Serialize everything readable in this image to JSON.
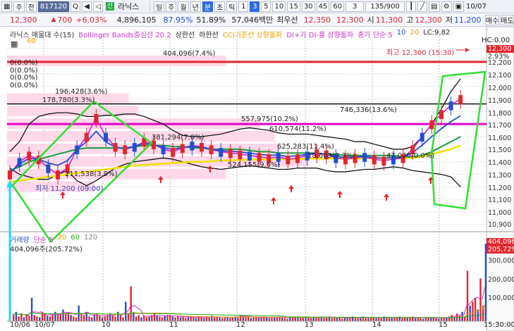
{
  "toolbar1": {
    "period_label": "주",
    "period_label2": "전",
    "code": "817120",
    "stock_name": "라닉스",
    "day": "일",
    "week": "주",
    "month": "월",
    "year": "년",
    "min": "분",
    "sec": "초",
    "tick": "틱",
    "intervals": [
      "1",
      "3",
      "5",
      "10",
      "15",
      "30",
      "45",
      "60"
    ],
    "interval_selected": "3",
    "count": "3",
    "page": "135/900",
    "date": "10/07"
  },
  "toolbar2": {
    "price": "12,300",
    "change_arrow": "▲",
    "change": "700",
    "change_pct": "+6.03%",
    "volume": "4,896,105",
    "vol_ratio": "87.95%",
    "strength": "51.89%",
    "amount": "57,046백만",
    "best_ask_label": "최우선",
    "best_ask": "12,350",
    "bid": "12,300",
    "open_label": "시",
    "open": "11,300",
    "high_label": "고",
    "high": "12,300",
    "low_label": "저",
    "low": "11,200",
    "buy_btn": "매수",
    "sell_btn": "매도"
  },
  "indicators": {
    "items": [
      "라닉스 매물대 수(15)",
      "Bollinger Bands중심선 20.2",
      "상한선",
      "하한선",
      "CCI기준선 상향돌파",
      "DI+가 DI-를 상향돌파",
      "종가 단순 5",
      "10",
      "20",
      "LC:9,82"
    ],
    "sub": "60"
  },
  "chart_labels": {
    "vp_top": "404,096(7.4%)",
    "z1": "0(0.0%)",
    "z2": "0(0.0%)",
    "z3": "0(0.0%)",
    "z4": "0(0.0%)",
    "vp_a": "196,428(3.6%)",
    "vp_b": "178,780(3.3%)",
    "vp_c": "557,975(10.2%)",
    "vp_d": "746,336(13.6%)",
    "vp_e": "610,574(11.2%)",
    "vp_f": "381,294(7.0%)",
    "vp_g": "625,283(11.4%)",
    "vp_h": "524,155(9.6%)",
    "vp_i": "211,538(3.9%)",
    "vp_j": "18,603(0.3%)",
    "vp_k": "47,020(0.0%)",
    "high_note": "최고 12,300 (15:30)",
    "low_note": "최저 11,200 (09:00)",
    "hc": "HC:0.00",
    "lc": "LC:9,82"
  },
  "price_axis": [
    "12,300",
    "12,200",
    "12,100",
    "12,000",
    "11,900",
    "11,800",
    "11,700",
    "11,600",
    "11,500",
    "11,400",
    "11,300",
    "11,200",
    "11,100",
    "11,000",
    "10,900"
  ],
  "price_axis_pct": "2.93%",
  "volume_axis": [
    "404,096",
    "205,72%",
    "300,000",
    "200,000",
    "100,000"
  ],
  "volume_legend": {
    "title": "거래량",
    "ma": "단순 5",
    "ma20": "20",
    "ma60": "60",
    "ma120": "120",
    "value": "404,096주(205.72%)"
  },
  "dates": [
    "10/06",
    "10/07",
    "10",
    "11",
    "12",
    "13",
    "14",
    "15"
  ],
  "time_label": "15:30:00",
  "colors": {
    "up": "#e3262d",
    "down": "#1f4fd1",
    "bb": "#000000",
    "band_fill": "#ffd1e6",
    "highlight": "#33dd33"
  },
  "volume_values": [
    0.08,
    0.12,
    0.06,
    0.1,
    0.05,
    0.09,
    0.07,
    0.3,
    0.08,
    0.06,
    0.05,
    0.12,
    0.1,
    0.07,
    0.06,
    0.08,
    0.12,
    0.09,
    0.1,
    0.15,
    0.1,
    0.12,
    0.08,
    0.06,
    0.05,
    0.2,
    0.1,
    0.08,
    0.12,
    0.06,
    0.05,
    0.08,
    0.1,
    0.07,
    0.05,
    0.06,
    0.08,
    0.1,
    0.08,
    0.06,
    0.12,
    0.08,
    0.05,
    0.25,
    0.1,
    0.45,
    0.12,
    0.06,
    0.08,
    0.05,
    0.07,
    0.05,
    0.06,
    0.08,
    0.1,
    0.07,
    0.06,
    0.05,
    0.07,
    0.08,
    0.08,
    0.06,
    0.05,
    0.07,
    0.05,
    0.06,
    0.04,
    0.05,
    0.06,
    0.05,
    0.04,
    0.06,
    0.05,
    0.04,
    0.06,
    0.05,
    0.07,
    0.05,
    0.06,
    0.05,
    0.04,
    0.05,
    0.06,
    0.04,
    0.05,
    0.06,
    0.05,
    0.08,
    0.07,
    0.06,
    0.05,
    0.04,
    0.06,
    0.05,
    0.04,
    0.05,
    0.06,
    0.05,
    0.04,
    0.05,
    0.04,
    0.05,
    0.06,
    0.05,
    0.04,
    0.03,
    0.05,
    0.04,
    0.06,
    0.05,
    0.04,
    0.05,
    0.06,
    0.05,
    0.04,
    0.05,
    0.05,
    0.04,
    0.06,
    0.05,
    0.05,
    0.06,
    0.04,
    0.05,
    0.04,
    0.05,
    0.03,
    0.04,
    0.05,
    0.04,
    0.06,
    0.05,
    0.04,
    0.05,
    0.06,
    0.05,
    0.04,
    0.05,
    0.05,
    0.04,
    0.05,
    0.04,
    0.06,
    0.05,
    0.04,
    0.05,
    0.04,
    0.05,
    0.06,
    0.04,
    0.05,
    0.04,
    0.05,
    0.06,
    0.04,
    0.05,
    0.04,
    0.03,
    0.05,
    0.04,
    0.04,
    0.05,
    0.04,
    0.03,
    0.05,
    0.04,
    0.05,
    0.06,
    0.08,
    0.05,
    0.1,
    0.07,
    0.12,
    0.06,
    0.65,
    0.2,
    0.25,
    0.3,
    0.15,
    0.55,
    0.2,
    1.0
  ]
}
